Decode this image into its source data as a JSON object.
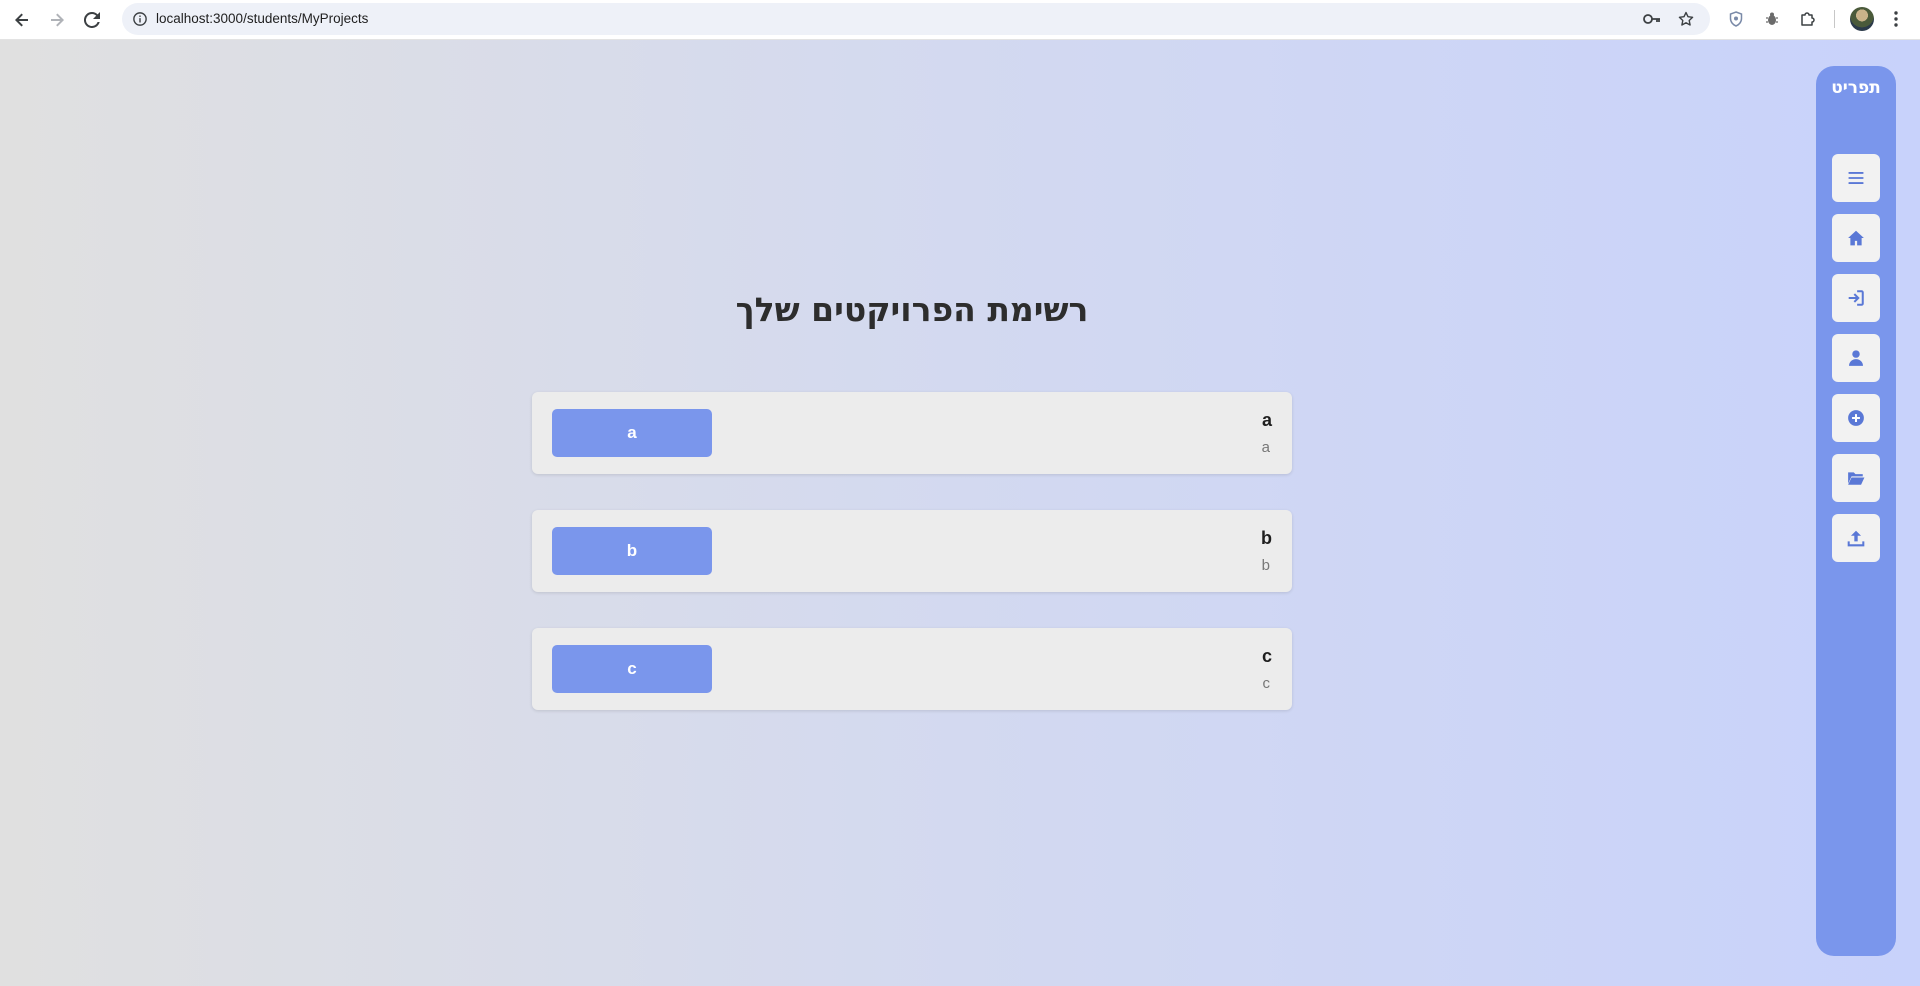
{
  "browser": {
    "url": "localhost:3000/students/MyProjects"
  },
  "page": {
    "title": "רשימת הפרויקטים שלך",
    "projects": [
      {
        "name": "a",
        "description": "a",
        "button_label": "a"
      },
      {
        "name": "b",
        "description": "b",
        "button_label": "b"
      },
      {
        "name": "c",
        "description": "c",
        "button_label": "c"
      }
    ]
  },
  "sidebar": {
    "brand": "תפריט",
    "items": [
      {
        "icon": "menu-icon"
      },
      {
        "icon": "home-icon"
      },
      {
        "icon": "login-icon"
      },
      {
        "icon": "user-icon"
      },
      {
        "icon": "add-circle-icon"
      },
      {
        "icon": "folder-open-icon"
      },
      {
        "icon": "upload-icon"
      }
    ]
  },
  "colors": {
    "accent": "#7a96ec",
    "card_bg": "#ececec",
    "icon_color": "#5a78d6"
  }
}
